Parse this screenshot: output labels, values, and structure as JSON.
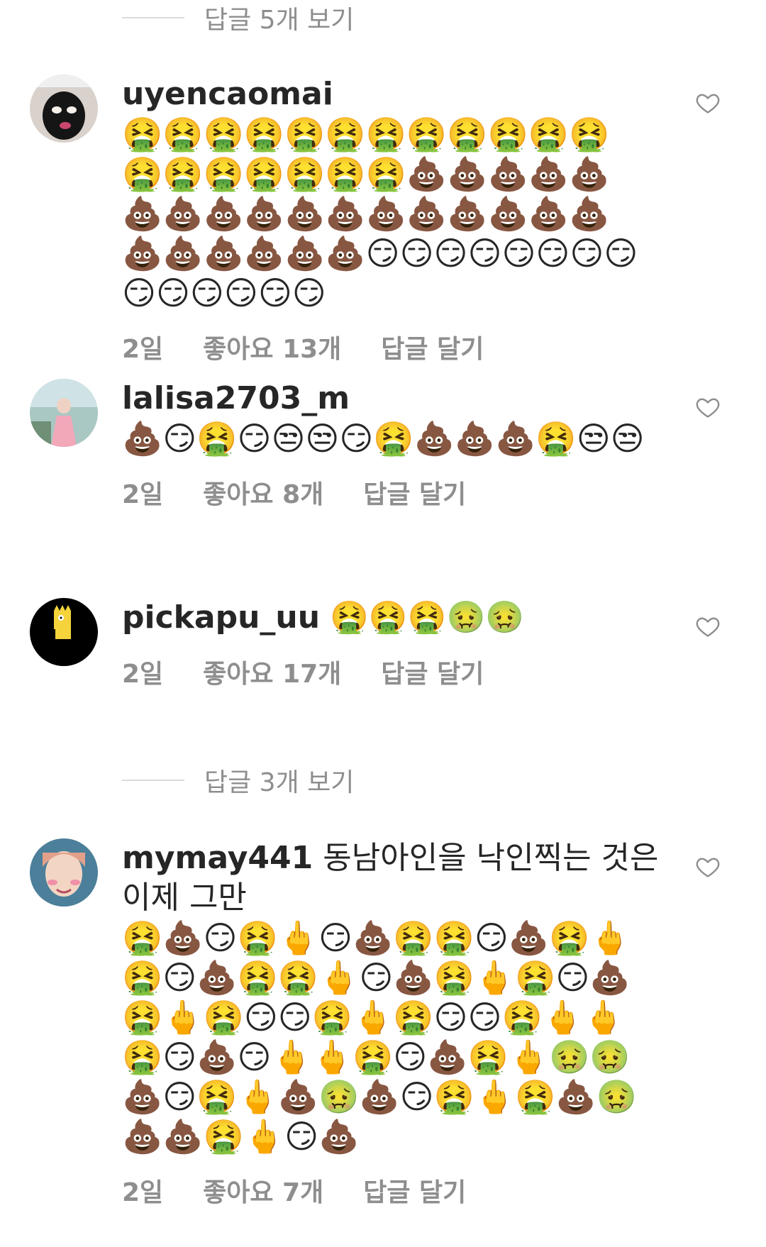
{
  "view_replies_top": "답글 5개 보기",
  "view_replies_mid": "답글 3개 보기",
  "comments": [
    {
      "username": "uyencaomai",
      "text": "",
      "emojis": "🤮🤮🤮🤮🤮🤮🤮🤮🤮🤮🤮🤮🤮🤮🤮🤮🤮🤮🤮💩💩💩💩💩💩💩💩💩💩💩💩💩💩💩💩💩💩💩💩💩💩💩😏😏😏😏😏😏😏😏😏😏😏😏😏😏",
      "time": "2일",
      "likes": "좋아요 13개",
      "reply": "답글 달기"
    },
    {
      "username": "lalisa2703_m",
      "text": "",
      "emojis": "💩😏🤮😏😒😒😏🤮💩💩💩🤮😒😒",
      "time": "2일",
      "likes": "좋아요 8개",
      "reply": "답글 달기"
    },
    {
      "username": "pickapu_uu",
      "text": "",
      "emojis": "🤮🤮🤮🤢🤢",
      "time": "2일",
      "likes": "좋아요 17개",
      "reply": "답글 달기"
    },
    {
      "username": "mymay441",
      "text": "동남아인을 낙인찍는 것은 이제 그만",
      "emojis": "🤮💩😏🤮🖕😏💩🤮🤮😏💩🤮🖕🤮😏💩🤮🤮🖕😏💩🤮🖕🤮😏💩🤮🖕🤮😏😏🤮🖕🤮😏😏🤮🖕🖕🤮😏💩😏🖕🖕🤮😏💩🤮🖕🤢🤢💩😏🤮🖕💩🤢💩😏🤮🖕🤮💩🤢💩💩🤮🖕😏💩",
      "time": "2일",
      "likes": "좋아요 7개",
      "reply": "답글 달기"
    }
  ]
}
